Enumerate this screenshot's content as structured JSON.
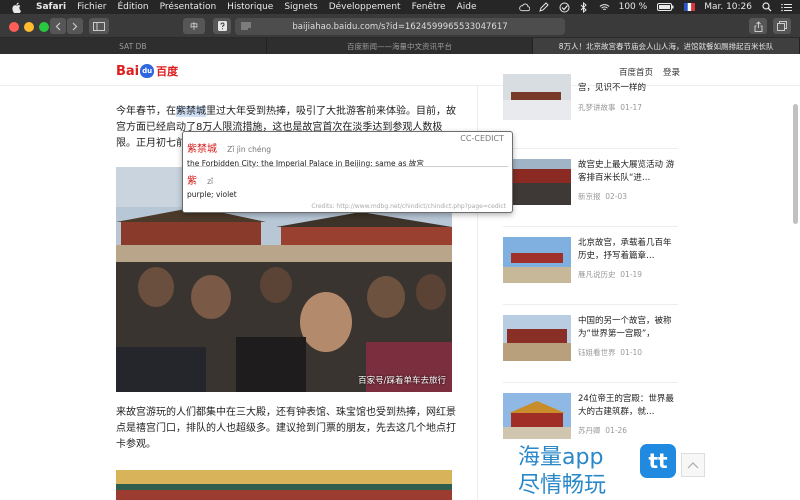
{
  "menubar": {
    "items": [
      "Safari",
      "Fichier",
      "Édition",
      "Présentation",
      "Historique",
      "Signets",
      "Développement",
      "Fenêtre",
      "Aide"
    ],
    "battery": "100 %",
    "clock": "Mar. 10:26"
  },
  "toolbar": {
    "url": "baijiahao.baidu.com/s?id=1624599965533047617",
    "translate_label": "中"
  },
  "tabs": [
    {
      "label": "SAT DB"
    },
    {
      "label": "百度新闻——海量中文资讯平台"
    },
    {
      "label": "8万人！北京故宫春节庙会人山人海，进馆就餐如厕排起百米长队"
    }
  ],
  "header": {
    "logo_text_a": "Bai",
    "logo_paw": "du",
    "logo_text_b": "百度",
    "link_home": "百度首页",
    "link_login": "登录"
  },
  "article": {
    "para1_pre": "今年春节，在",
    "para1_hl": "紫禁城",
    "para1_post": "里过大年受到热捧，吸引了大批游客前来体验。目前，故宫方面已经启动了8万人限流措施，这也是故宫首次在淡季达到参观人数极限。正月初七前",
    "photo1_caption": "百家号/踩着单车去旅行",
    "para2": "来故宫游玩的人们都集中在三大殿，还有钟表馆、珠宝馆也受到热捧，网红景点是禧宫门口，排队的人也超级多。建议抢到门票的朋友，先去这几个地点打卡参观。"
  },
  "dictionary": {
    "source": "CC-CEDICT",
    "entries": [
      {
        "hanzi": "紫禁城",
        "pinyin": "Zǐ jìn chéng",
        "definition": "the Forbidden City; the Imperial Palace in Beijing; same as 故宫"
      },
      {
        "hanzi": "紫",
        "pinyin": "zǐ",
        "definition": "purple; violet"
      }
    ],
    "credits": "Credits: http://www.mdbg.net/chindict/chindict.php?page=cedict"
  },
  "sidebar": {
    "items": [
      {
        "title": "宫，见识不一样的",
        "source": "孔梦讲故事",
        "date": "01-17"
      },
      {
        "title": "故宫史上最大展览活动 游客排百米长队“进…",
        "source": "新京报",
        "date": "02-03"
      },
      {
        "title": "北京故宫，承载着几百年历史，抒写着篇章…",
        "source": "雁凡说历史",
        "date": "01-19"
      },
      {
        "title": "中国的另一个故宫，被称为“世界第一宫殿”，",
        "source": "钰姐看世界",
        "date": "01-10"
      },
      {
        "title": "24位帝王的宫殿：世界最大的古建筑群，就…",
        "source": "苏丹卿",
        "date": "01-26"
      }
    ],
    "ad_line1": "海量app",
    "ad_line2": "尽情畅玩",
    "ad_logo": "tt"
  }
}
